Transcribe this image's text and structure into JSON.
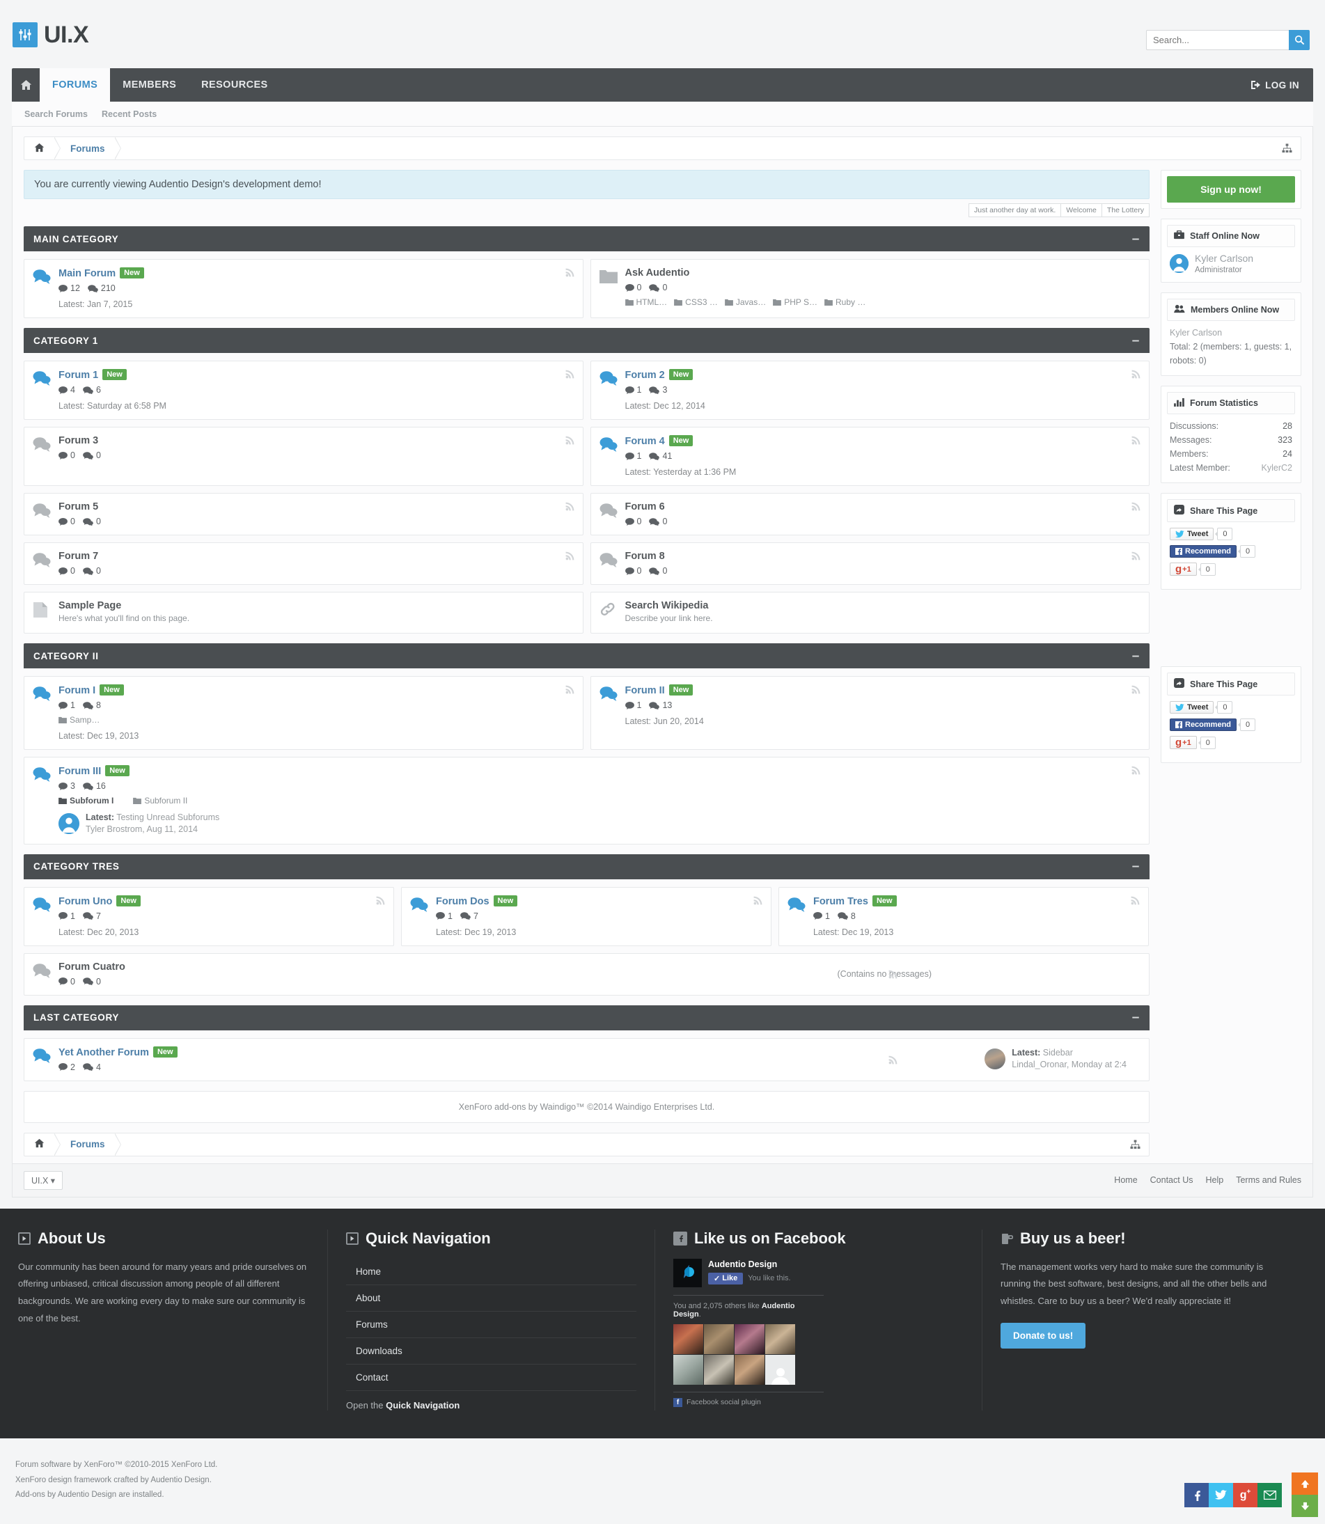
{
  "brand": {
    "name": "UI.X",
    "logo_icon": "sliders-icon"
  },
  "search": {
    "placeholder": "Search...",
    "value": "",
    "icon": "search-icon"
  },
  "nav": {
    "home_icon": "home-icon",
    "tabs": [
      {
        "label": "FORUMS",
        "active": true
      },
      {
        "label": "MEMBERS",
        "active": false
      },
      {
        "label": "RESOURCES",
        "active": false
      }
    ],
    "login_label": "LOG IN",
    "login_icon": "login-icon",
    "sub_links": [
      "Search Forums",
      "Recent Posts"
    ]
  },
  "breadcrumb": {
    "home_icon": "home-icon",
    "link": "Forums",
    "jump_icon": "sitemap-icon"
  },
  "notice": {
    "text": "You are currently viewing Audentio Design's development demo!",
    "tabs": [
      "Just another day at work.",
      "Welcome",
      "The Lottery"
    ]
  },
  "categories": [
    {
      "title": "MAIN CATEGORY",
      "collapse": "–",
      "layout": "half",
      "nodes": [
        {
          "name": "Main Forum",
          "new": true,
          "unread": true,
          "icon": "forum-icon",
          "discussions": "12",
          "messages": "210",
          "latest": "Latest: Jan 7, 2015",
          "rss": true
        },
        {
          "name": "Ask Audentio",
          "new": false,
          "unread": false,
          "icon": "category-folder-icon",
          "discussions": "0",
          "messages": "0",
          "subs": [
            "HTML…",
            "CSS3 …",
            "Javas…",
            "PHP S…",
            "Ruby …"
          ]
        }
      ]
    },
    {
      "title": "CATEGORY 1",
      "collapse": "–",
      "layout": "half",
      "nodes": [
        {
          "name": "Forum 1",
          "new": true,
          "unread": true,
          "icon": "forum-icon",
          "discussions": "4",
          "messages": "6",
          "latest": "Latest: Saturday at 6:58 PM",
          "rss": true
        },
        {
          "name": "Forum 2",
          "new": true,
          "unread": true,
          "icon": "forum-icon",
          "discussions": "1",
          "messages": "3",
          "latest": "Latest: Dec 12, 2014",
          "rss": true
        },
        {
          "name": "Forum 3",
          "new": false,
          "unread": false,
          "icon": "forum-icon-read",
          "discussions": "0",
          "messages": "0",
          "rss": true
        },
        {
          "name": "Forum 4",
          "new": true,
          "unread": true,
          "icon": "forum-icon",
          "discussions": "1",
          "messages": "41",
          "latest": "Latest: Yesterday at 1:36 PM",
          "rss": true
        },
        {
          "name": "Forum 5",
          "new": false,
          "unread": false,
          "icon": "forum-icon-read",
          "discussions": "0",
          "messages": "0",
          "rss": true
        },
        {
          "name": "Forum 6",
          "new": false,
          "unread": false,
          "icon": "forum-icon-read",
          "discussions": "0",
          "messages": "0",
          "rss": true
        },
        {
          "name": "Forum 7",
          "new": false,
          "unread": false,
          "icon": "forum-icon-read",
          "discussions": "0",
          "messages": "0",
          "rss": true
        },
        {
          "name": "Forum 8",
          "new": false,
          "unread": false,
          "icon": "forum-icon-read",
          "discussions": "0",
          "messages": "0",
          "rss": true
        },
        {
          "name": "Sample Page",
          "new": false,
          "unread": false,
          "icon": "page-icon",
          "description": "Here's what you'll find on this page."
        },
        {
          "name": "Search Wikipedia",
          "new": false,
          "unread": false,
          "icon": "link-icon",
          "description": "Describe your link here."
        }
      ]
    },
    {
      "title": "CATEGORY II",
      "collapse": "–",
      "layout": "half",
      "nodes": [
        {
          "name": "Forum I",
          "new": true,
          "unread": true,
          "icon": "forum-icon",
          "discussions": "1",
          "messages": "8",
          "subs": [
            "Samp…"
          ],
          "latest": "Latest: Dec 19, 2013",
          "rss": true
        },
        {
          "name": "Forum II",
          "new": true,
          "unread": true,
          "icon": "forum-icon",
          "discussions": "1",
          "messages": "13",
          "latest": "Latest: Jun 20, 2014",
          "rss": true
        },
        {
          "name": "Forum III",
          "new": true,
          "unread": true,
          "icon": "forum-icon",
          "full": true,
          "discussions": "3",
          "messages": "16",
          "subs_full": [
            {
              "label": "Subforum I",
              "unread": true
            },
            {
              "label": "Subforum II",
              "unread": false
            }
          ],
          "last_post": {
            "prefix": "Latest:",
            "title": "Testing Unread Subforums",
            "user": "Tyler Brostrom",
            "date": "Aug 11, 2014",
            "avatar": "user-avatar"
          },
          "rss": true
        }
      ]
    },
    {
      "title": "CATEGORY TRES",
      "collapse": "–",
      "layout": "third",
      "nodes": [
        {
          "name": "Forum Uno",
          "new": true,
          "unread": true,
          "icon": "forum-icon",
          "discussions": "1",
          "messages": "7",
          "latest": "Latest: Dec 20, 2013",
          "rss": true
        },
        {
          "name": "Forum Dos",
          "new": true,
          "unread": true,
          "icon": "forum-icon",
          "discussions": "1",
          "messages": "7",
          "latest": "Latest: Dec 19, 2013",
          "rss": true
        },
        {
          "name": "Forum Tres",
          "new": true,
          "unread": true,
          "icon": "forum-icon",
          "discussions": "1",
          "messages": "8",
          "latest": "Latest: Dec 19, 2013",
          "rss": true
        },
        {
          "name": "Forum Cuatro",
          "new": false,
          "unread": false,
          "icon": "forum-icon-read",
          "wide": true,
          "discussions": "0",
          "messages": "0",
          "empty_note": "(Contains no messages)",
          "rss": true
        }
      ]
    },
    {
      "title": "LAST CATEGORY",
      "collapse": "–",
      "layout": "full",
      "nodes": [
        {
          "name": "Yet Another Forum",
          "new": true,
          "unread": true,
          "icon": "forum-icon",
          "wide": true,
          "discussions": "2",
          "messages": "4",
          "rss": true,
          "last_post": {
            "prefix": "Latest:",
            "title": "Sidebar",
            "user": "Lindal_Oronar",
            "date": "Monday at 2:4",
            "avatar": "photo-avatar"
          }
        }
      ]
    }
  ],
  "sidebar": {
    "signup_label": "Sign up now!",
    "staff": {
      "title": "Staff Online Now",
      "icon": "briefcase-icon",
      "members": [
        {
          "name": "Kyler Carlson",
          "role": "Administrator",
          "avatar": "user-avatar"
        }
      ]
    },
    "members_online": {
      "title": "Members Online Now",
      "icon": "users-icon",
      "names": "Kyler Carlson",
      "total": "Total: 2 (members: 1, guests: 1, robots: 0)"
    },
    "statistics": {
      "title": "Forum Statistics",
      "icon": "chart-bar-icon",
      "rows": [
        {
          "label": "Discussions:",
          "value": "28",
          "muted": false
        },
        {
          "label": "Messages:",
          "value": "323",
          "muted": false
        },
        {
          "label": "Members:",
          "value": "24",
          "muted": false
        },
        {
          "label": "Latest Member:",
          "value": "KylerC2",
          "muted": true
        }
      ]
    },
    "share": {
      "title": "Share This Page",
      "icon": "share-icon",
      "tweet_label": "Tweet",
      "tweet_count": "0",
      "fb_label": "Recommend",
      "fb_count": "0",
      "gp_label": "+1",
      "gp_count": "0"
    }
  },
  "addon_credit": "XenForo add-ons by Waindigo™ ©2014 Waindigo Enterprises Ltd.",
  "bottom": {
    "style_chooser": "UI.X",
    "links": [
      "Home",
      "Contact Us",
      "Help",
      "Terms and Rules"
    ]
  },
  "footer": {
    "about": {
      "title": "About Us",
      "text": "Our community has been around for many years and pride ourselves on offering unbiased, critical discussion among people of all different backgrounds. We are working every day to make sure our community is one of the best."
    },
    "quicknav": {
      "title": "Quick Navigation",
      "items": [
        "Home",
        "About",
        "Forums",
        "Downloads",
        "Contact"
      ],
      "open_prefix": "Open the ",
      "open_link": "Quick Navigation"
    },
    "facebook": {
      "title": "Like us on Facebook",
      "page_name": "Audentio Design",
      "like_label": "Like",
      "you_like": "You like this.",
      "others": "You and 2,075 others like ",
      "others_bold": "Audentio Design",
      "plugin_label": "Facebook social plugin"
    },
    "beer": {
      "title": "Buy us a beer!",
      "text": "The management works very hard to make sure the community is running the best software, best designs, and all the other bells and whistles. Care to buy us a beer? We'd really appreciate it!",
      "donate_label": "Donate to us!"
    }
  },
  "copyright": {
    "line1": "Forum software by XenForo™ ©2010-2015 XenForo Ltd.",
    "line2": "XenForo design framework crafted by Audentio Design.",
    "line3": "Add-ons by Audentio Design are installed."
  },
  "social": [
    "facebook-icon",
    "twitter-icon",
    "googleplus-icon",
    "email-icon"
  ],
  "scroll": {
    "up_icon": "arrow-up-icon",
    "down_icon": "arrow-down-icon"
  }
}
